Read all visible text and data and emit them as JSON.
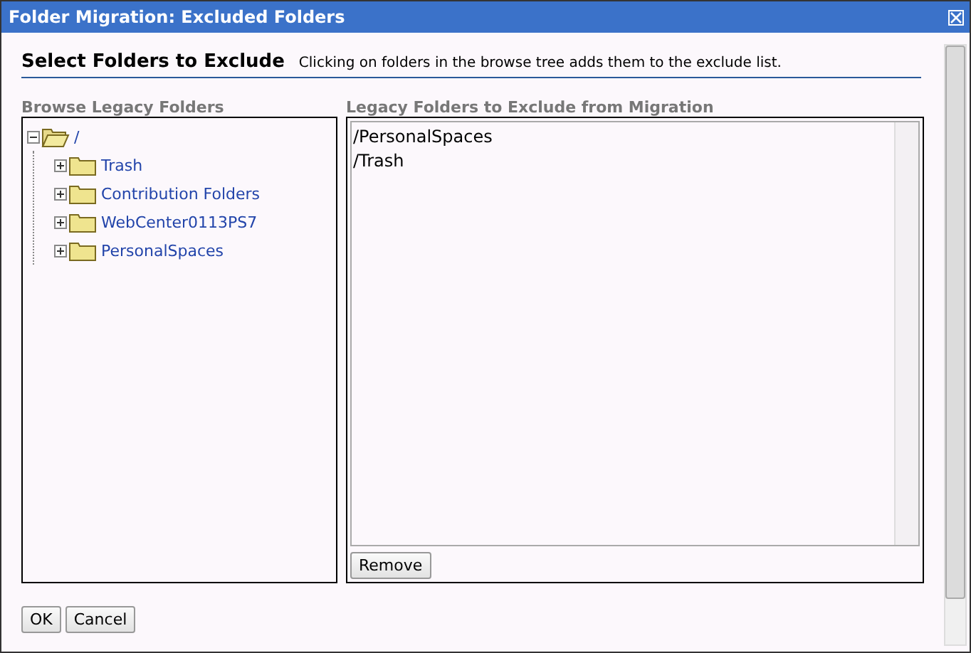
{
  "window": {
    "title": "Folder Migration: Excluded Folders"
  },
  "heading": {
    "title": "Select Folders to Exclude",
    "hint": "Clicking on folders in the browse tree adds them to the exclude list."
  },
  "browse": {
    "label": "Browse Legacy Folders",
    "tree": [
      {
        "label": "/",
        "expanded": true,
        "children": [
          {
            "label": "Trash",
            "expanded": false
          },
          {
            "label": "Contribution Folders",
            "expanded": false
          },
          {
            "label": "WebCenter0113PS7",
            "expanded": false
          },
          {
            "label": "PersonalSpaces",
            "expanded": false
          }
        ]
      }
    ]
  },
  "exclude": {
    "label": "Legacy Folders to Exclude from Migration",
    "items": [
      "/PersonalSpaces",
      "/Trash"
    ],
    "button": "Remove"
  },
  "buttons": [
    "OK",
    "Cancel"
  ]
}
